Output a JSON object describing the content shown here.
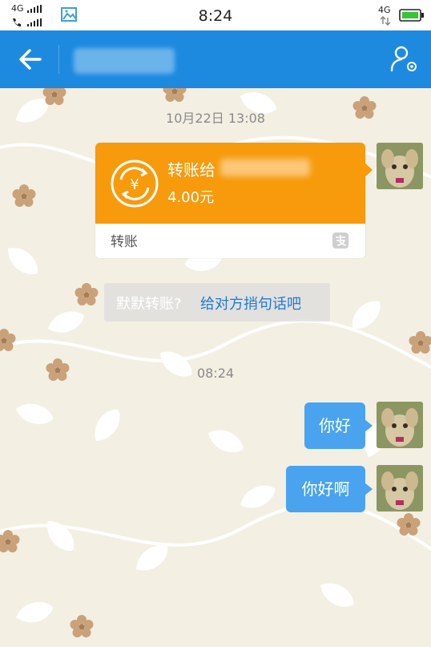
{
  "status_bar": {
    "network_left_top": "4G",
    "network_left_bottom": "",
    "time": "8:24",
    "network_right": "4G"
  },
  "title_bar": {
    "back_icon": "back-arrow-icon",
    "profile_icon": "profile-settings-icon",
    "contact_name_redacted": true
  },
  "chat": {
    "timestamp_1": "10月22日 13:08",
    "transfer_card": {
      "title": "转账给",
      "amount": "4.00元",
      "footer_label": "转账",
      "icon": "currency-transfer-icon",
      "footer_icon": "alipay-icon"
    },
    "hint": {
      "prefix": "默默转账?",
      "link": "给对方捎句话吧"
    },
    "timestamp_2": "08:24",
    "messages": [
      {
        "text": "你好",
        "side": "right"
      },
      {
        "text": "你好啊",
        "side": "right"
      }
    ]
  },
  "colors": {
    "title_bar": "#1d8ae0",
    "transfer_orange": "#f79a0c",
    "bubble_blue": "#4aa3ee",
    "link_blue": "#1d7ad6",
    "chat_bg": "#f3efe3"
  }
}
